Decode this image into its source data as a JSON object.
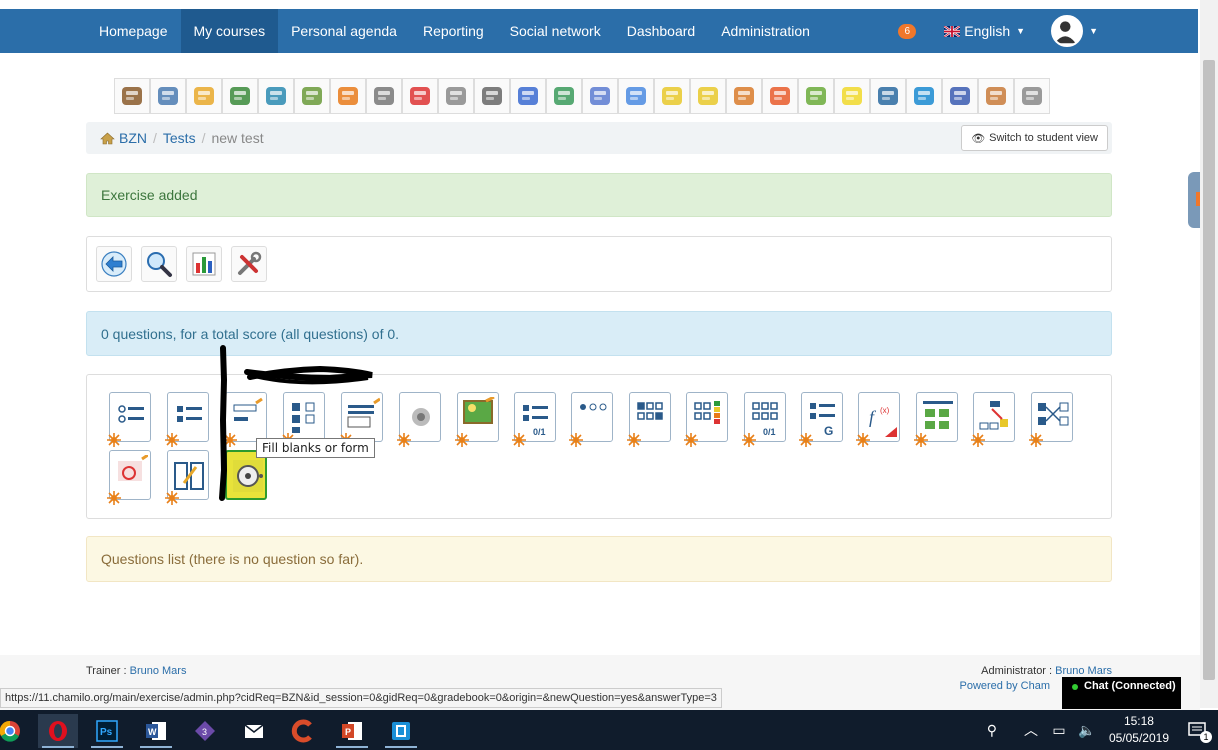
{
  "nav": {
    "items": [
      {
        "label": "Homepage",
        "active": false
      },
      {
        "label": "My courses",
        "active": true
      },
      {
        "label": "Personal agenda",
        "active": false
      },
      {
        "label": "Reporting",
        "active": false
      },
      {
        "label": "Social network",
        "active": false
      },
      {
        "label": "Dashboard",
        "active": false
      },
      {
        "label": "Administration",
        "active": false
      }
    ],
    "notifications": "6",
    "language": "English"
  },
  "tools": [
    "home-icon",
    "course-description-icon",
    "documents-icon",
    "learning-path-icon",
    "links-icon",
    "tests-icon",
    "announcements-icon",
    "assessments-icon",
    "glossary-icon",
    "attendance-icon",
    "wiki-icon",
    "agenda-icon",
    "groups-icon",
    "dropbox-icon",
    "users-icon",
    "chat-icon",
    "forum-icon",
    "blog-icon",
    "course-progress-icon",
    "notebook-icon",
    "survey-icon",
    "videoconference-icon",
    "assignments-icon",
    "shared-documents-icon",
    "settings-icon",
    "maintenance-icon"
  ],
  "breadcrumb": {
    "items": [
      "BZN",
      "Tests"
    ],
    "current": "new test",
    "student_view": "Switch to student view"
  },
  "alerts": {
    "success": "Exercise added",
    "info": "0 questions, for a total score (all questions) of 0.",
    "warning": "Questions list (there is no question so far)."
  },
  "actions": [
    "back-icon",
    "preview-icon",
    "results-icon",
    "settings-icon"
  ],
  "tooltip": "Fill blanks or form",
  "footer": {
    "trainer_label": "Trainer : ",
    "trainer_name": "Bruno Mars",
    "admin_label": "Administrator : ",
    "admin_name": "Bruno Mars",
    "powered": "Powered by Cham"
  },
  "chat": "Chat (Connected)",
  "status_url": "https://11.chamilo.org/main/exercise/admin.php?cidReq=BZN&id_session=0&gidReq=0&gradebook=0&origin=&newQuestion=yes&answerType=3",
  "taskbar": {
    "time": "15:18",
    "date": "05/05/2019",
    "notification_count": "1"
  },
  "colors": {
    "navbar": "#2b6ea9",
    "success_bg": "#dff0d8",
    "info_bg": "#d9edf7",
    "warning_bg": "#fcf8e3"
  }
}
